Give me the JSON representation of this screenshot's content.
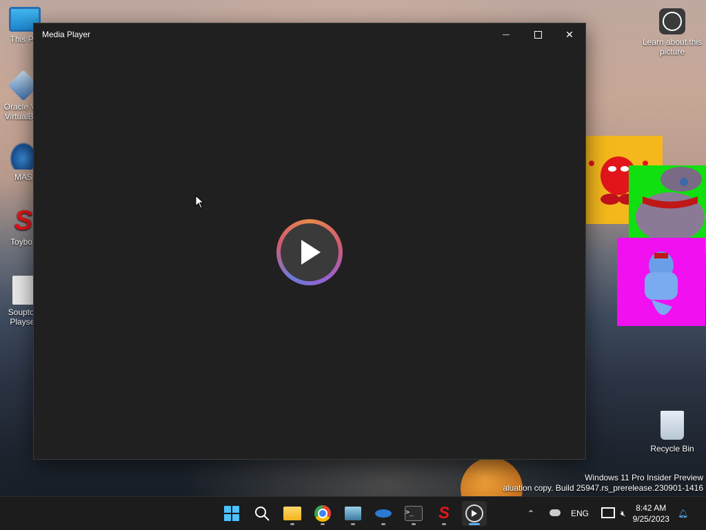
{
  "desktop": {
    "icons": [
      {
        "name": "this-pc",
        "label": "This PC"
      },
      {
        "name": "oracle-virtualbox",
        "label": "Oracle VM VirtualBox"
      },
      {
        "name": "mas",
        "label": "MAS"
      },
      {
        "name": "toybox",
        "label": "Toybox"
      },
      {
        "name": "soupton-playset",
        "label": "Soupton Playset"
      }
    ],
    "learn_picture": "Learn about this picture",
    "recycle_bin": "Recycle Bin",
    "watermark_line1": "Windows 11 Pro Insider Preview",
    "watermark_line2": "aluation copy. Build 25947.rs_prerelease.230901-1416"
  },
  "window": {
    "title": "Media Player",
    "minimize_glyph": "—",
    "maximize_glyph": "☐",
    "close_glyph": "✕",
    "play_icon": "play-icon"
  },
  "taskbar": {
    "apps": [
      "start",
      "search",
      "file-explorer",
      "chrome",
      "keyboard-app",
      "mas-app",
      "terminal",
      "toybox-app",
      "media-player"
    ],
    "tray": {
      "language": "ENG",
      "time": "8:42 AM",
      "date": "9/25/2023"
    }
  },
  "colors": {
    "accent": "#5bb0ff",
    "window_bg": "#202020",
    "taskbar_bg": "#1c1c1c"
  }
}
